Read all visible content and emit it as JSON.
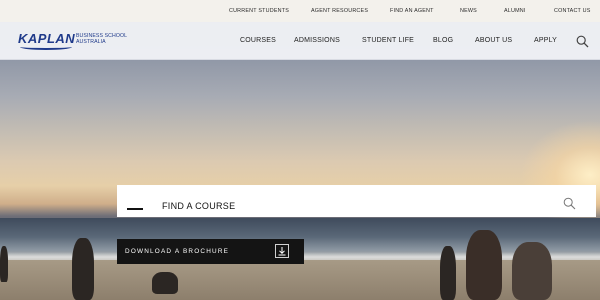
{
  "utility_nav": {
    "items": [
      "CURRENT STUDENTS",
      "AGENT RESOURCES",
      "FIND AN AGENT",
      "NEWS",
      "ALUMNI",
      "CONTACT US"
    ]
  },
  "header": {
    "logo_word": "KAPLAN",
    "logo_sub_line1": "BUSINESS SCHOOL",
    "logo_sub_line2": "AUSTRALIA",
    "nav": [
      "COURSES",
      "ADMISSIONS",
      "STUDENT LIFE",
      "BLOG",
      "ABOUT US",
      "APPLY"
    ],
    "search_icon": "search-icon"
  },
  "hero": {
    "course_search_label": "FIND A COURSE",
    "course_search_icon": "search-icon",
    "brochure_label": "DOWNLOAD A BROCHURE",
    "brochure_icon": "download-icon"
  },
  "colors": {
    "brand": "#1f3a8a",
    "button_bg": "#141414"
  }
}
